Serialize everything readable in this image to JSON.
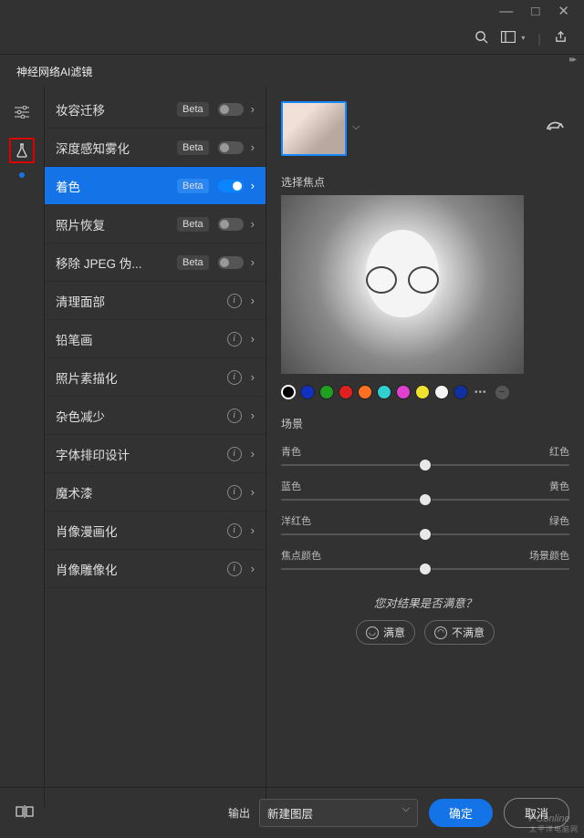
{
  "titlebar": {
    "min": "—",
    "max": "□",
    "close": "✕"
  },
  "toolbar": {
    "search_icon": "search",
    "layout_icon": "layout",
    "share_icon": "share"
  },
  "panel": {
    "title": "神经网络AI滤镜"
  },
  "rail": {
    "sliders_icon": "sliders",
    "flask_icon": "flask"
  },
  "filters": [
    {
      "name": "妆容迁移",
      "beta": "Beta",
      "on": false,
      "toggle": true
    },
    {
      "name": "深度感知雾化",
      "beta": "Beta",
      "on": false,
      "toggle": true
    },
    {
      "name": "着色",
      "beta": "Beta",
      "on": true,
      "toggle": true,
      "active": true
    },
    {
      "name": "照片恢复",
      "beta": "Beta",
      "on": false,
      "toggle": true
    },
    {
      "name": "移除 JPEG 伪...",
      "beta": "Beta",
      "on": false,
      "toggle": true
    },
    {
      "name": "清理面部",
      "info": true
    },
    {
      "name": "铅笔画",
      "info": true
    },
    {
      "name": "照片素描化",
      "info": true
    },
    {
      "name": "杂色减少",
      "info": true
    },
    {
      "name": "字体排印设计",
      "info": true
    },
    {
      "name": "魔术漆",
      "info": true
    },
    {
      "name": "肖像漫画化",
      "info": true
    },
    {
      "name": "肖像雕像化",
      "info": true
    }
  ],
  "right": {
    "focus_label": "选择焦点",
    "swatch_colors": [
      "#000000",
      "#1030c0",
      "#20a020",
      "#e02020",
      "#ff7020",
      "#30d0d0",
      "#e040d0",
      "#f0e030",
      "#f5f5f5",
      "#1030a0"
    ],
    "scene_label": "场景",
    "sliders": [
      {
        "left": "青色",
        "right": "红色",
        "pos": 50
      },
      {
        "left": "蓝色",
        "right": "黄色",
        "pos": 50
      },
      {
        "left": "洋红色",
        "right": "绿色",
        "pos": 50
      },
      {
        "left": "焦点颜色",
        "right": "场景颜色",
        "pos": 50
      }
    ],
    "feedback_q": "您对结果是否满意？",
    "fb_yes": "满意",
    "fb_no": "不满意"
  },
  "footer": {
    "output_label": "输出",
    "output_value": "新建图层",
    "ok": "确定",
    "cancel": "取消"
  },
  "watermark": {
    "main": "PConline",
    "sub": "太平洋电脑网"
  }
}
